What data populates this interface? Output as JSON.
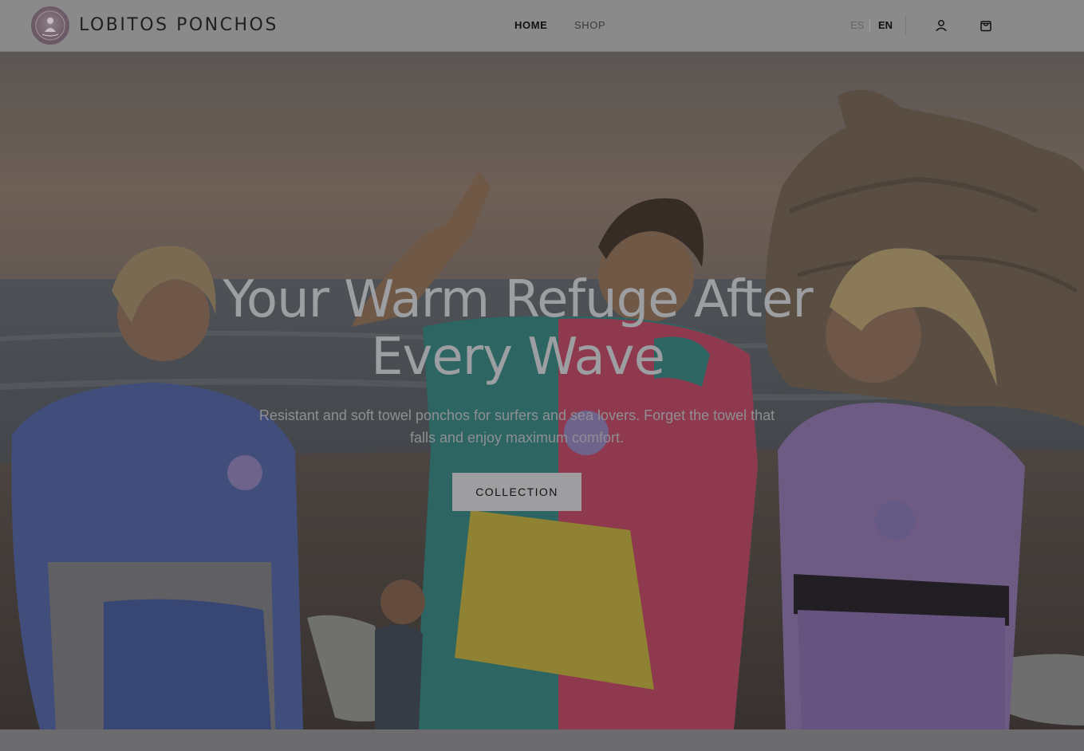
{
  "header": {
    "brand_name": "LOBITOS PONCHOS",
    "logo_icon": "surfer-seal-logo",
    "nav": {
      "home": "HOME",
      "shop": "SHOP"
    },
    "languages": {
      "es": "ES",
      "en": "EN",
      "active": "EN"
    },
    "account_icon": "user-icon",
    "cart_icon": "shopping-bag-icon"
  },
  "hero": {
    "title": "Your Warm Refuge After Every Wave",
    "subtitle": "Resistant and soft towel ponchos for surfers and sea lovers. Forget the towel that falls and enjoy maximum comfort.",
    "cta_label": "COLLECTION",
    "image_subject": "three-people-in-towel-ponchos-on-beach-at-sunset"
  },
  "colors": {
    "header_bg": "#8a8a8b",
    "cta_bg": "#9e9ea0",
    "poncho_teal": "#2f7d78",
    "poncho_pink": "#b8405e",
    "poncho_yellow": "#b7a537",
    "poncho_blue": "#4b5d9a",
    "poncho_lilac": "#8a6fa6"
  }
}
